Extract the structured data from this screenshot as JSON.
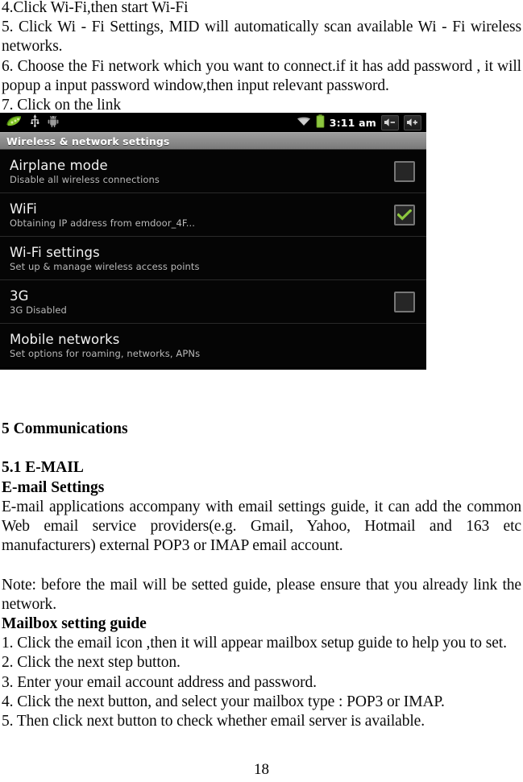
{
  "document": {
    "intro_lines": [
      "4.Click Wi-Fi,then start Wi-Fi",
      "5. Click Wi - Fi Settings, MID will automatically scan available Wi - Fi wireless networks.",
      "6. Choose the Fi network which you want to connect.if it has add password , it will popup a input password window,then input relevant password.",
      "7. Click on the link"
    ],
    "section_heading": "5 Communications",
    "subsection_heading": "5.1 E-MAIL",
    "subsubsection_heading": "E-mail Settings",
    "paragraph_email": "E-mail applications accompany with email settings guide, it can add the common Web email service providers(e.g. Gmail, Yahoo, Hotmail and 163 etc manufacturers) external POP3 or IMAP email account.",
    "note_paragraph": "Note: before the mail will be setted guide, please ensure that you already link the network.",
    "mailbox_heading": "Mailbox setting guide",
    "mailbox_steps": [
      "1. Click the email icon ,then it will appear mailbox setup guide to help you to set.",
      "2. Click the next step button.",
      "3. Enter your email account address and password.",
      "4. Click the next button, and select your mailbox type : POP3 or IMAP.",
      "5. Then click next button to check whether email server is available."
    ],
    "page_number": "18"
  },
  "screenshot": {
    "statusbar": {
      "left_icons": [
        "pea-pod-icon",
        "usb-icon",
        "android-bug-icon"
      ],
      "wifi_icon": "wifi-signal-icon",
      "battery_icon": "battery-full-icon",
      "clock": "3:11 am",
      "volume_down_icon": "volume-down-icon",
      "volume_up_icon": "volume-up-icon"
    },
    "title": "Wireless & network settings",
    "rows": [
      {
        "title": "Airplane mode",
        "subtitle": "Disable all wireless connections",
        "control": "checkbox",
        "checked": false
      },
      {
        "title": "WiFi",
        "subtitle": "Obtaining IP address from emdoor_4F...",
        "control": "checkbox",
        "checked": true
      },
      {
        "title": "Wi-Fi settings",
        "subtitle": "Set up & manage wireless access points",
        "control": "none",
        "checked": false
      },
      {
        "title": "3G",
        "subtitle": "3G Disabled",
        "control": "checkbox",
        "checked": false
      },
      {
        "title": "Mobile networks",
        "subtitle": "Set options for roaming, networks, APNs",
        "control": "none",
        "checked": false
      }
    ],
    "colors": {
      "background": "#000000",
      "title_bar": "#8a8a8a",
      "accent_green": "#8cc63e",
      "title_text": "#f2f2f2",
      "subtitle_text": "#b9b9b9"
    }
  }
}
